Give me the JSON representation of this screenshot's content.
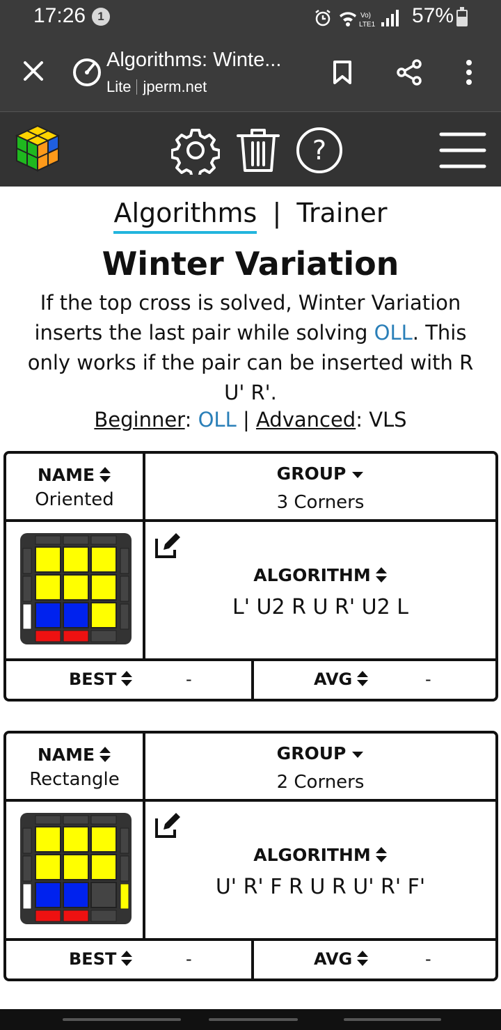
{
  "status": {
    "time": "17:26",
    "notif_count": "1",
    "battery": "57%"
  },
  "browser": {
    "title": "Algorithms: Winte...",
    "mode": "Lite",
    "domain": "jperm.net"
  },
  "nav": {
    "tab_algorithms": "Algorithms",
    "tab_sep": "|",
    "tab_trainer": "Trainer"
  },
  "page": {
    "title": "Winter Variation",
    "desc_part1": "If the top cross is solved, Winter Variation inserts the last pair while solving ",
    "desc_link": "OLL",
    "desc_part2": ". This only works if the pair can be inserted with R U' R'.",
    "beginner_label": "Beginner",
    "beginner_colon": ":",
    "beginner_value": "OLL",
    "level_sep": "|",
    "advanced_label": "Advanced",
    "advanced_value": ": VLS"
  },
  "colors": {
    "accent": "#22b5dd",
    "link": "#2a7fb8",
    "yellow": "#ffff00",
    "blue": "#0022ee",
    "red": "#ee1111",
    "dark": "#333333"
  },
  "cards": [
    {
      "name_header": "NAME",
      "name": "Oriented",
      "group_header": "GROUP",
      "group": "3 Corners",
      "alg_header": "ALGORITHM",
      "alg": "L' U2 R U R' U2 L",
      "best_label": "BEST",
      "best": "-",
      "avg_label": "AVG",
      "avg": "-"
    },
    {
      "name_header": "NAME",
      "name": "Rectangle",
      "group_header": "GROUP",
      "group": "2 Corners",
      "alg_header": "ALGORITHM",
      "alg": "U' R' F R U R U' R' F'",
      "best_label": "BEST",
      "best": "-",
      "avg_label": "AVG",
      "avg": "-"
    }
  ]
}
